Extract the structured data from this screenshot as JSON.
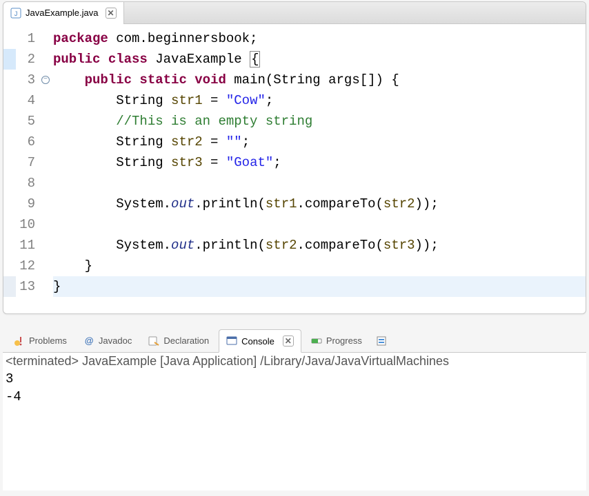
{
  "editor": {
    "tab": {
      "filename": "JavaExample.java"
    },
    "lines": {
      "n1": "1",
      "n2": "2",
      "n3": "3",
      "n4": "4",
      "n5": "5",
      "n6": "6",
      "n7": "7",
      "n8": "8",
      "n9": "9",
      "n10": "10",
      "n11": "11",
      "n12": "12",
      "n13": "13"
    },
    "code": {
      "l1": {
        "kw_package": "package",
        "pkg": " com.beginnersbook;"
      },
      "l2": {
        "kw_public": "public",
        "kw_class": "class",
        "name": " JavaExample ",
        "brace": "{"
      },
      "l3": {
        "indent": "    ",
        "kw_public": "public",
        "kw_static": " static",
        "kw_void": " void",
        "method": " main(String args[]) {",
        "type_string": "String",
        "main_sig1": " main(",
        "args": " args[]) {"
      },
      "l4": {
        "indent": "        ",
        "type": "String",
        "mid": " str1 = ",
        "var": "str1",
        "eq": " = ",
        "str": "\"Cow\"",
        "semi": ";"
      },
      "l5": {
        "indent": "        ",
        "comment": "//This is an empty string"
      },
      "l6": {
        "indent": "        ",
        "type": "String",
        "var": "str2",
        "eq": " = ",
        "str": "\"\"",
        "semi": ";"
      },
      "l7": {
        "indent": "        ",
        "type": "String",
        "var": "str3",
        "eq": " = ",
        "str": "\"Goat\"",
        "semi": ";"
      },
      "l8": {
        "blank": ""
      },
      "l9": {
        "indent": "        ",
        "sys": "System.",
        "out": "out",
        "mid": ".println(",
        "v1": "str1",
        "cmp": ".compareTo(",
        "v2": "str2",
        "end": "));"
      },
      "l10": {
        "blank": ""
      },
      "l11": {
        "indent": "        ",
        "sys": "System.",
        "out": "out",
        "mid": ".println(",
        "v1": "str2",
        "cmp": ".compareTo(",
        "v2": "str3",
        "end": "));"
      },
      "l12": {
        "indent": "    ",
        "brace": "}"
      },
      "l13": {
        "brace": "}"
      }
    }
  },
  "bottomTabs": {
    "problems": "Problems",
    "javadoc": "Javadoc",
    "declaration": "Declaration",
    "console": "Console",
    "progress": "Progress"
  },
  "console": {
    "status": "<terminated> JavaExample [Java Application] /Library/Java/JavaVirtualMachines",
    "out1": "3",
    "out2": "-4"
  }
}
